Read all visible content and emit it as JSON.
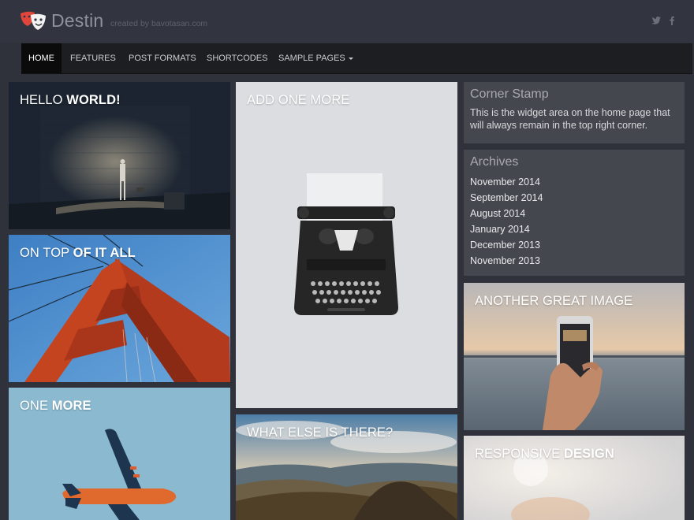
{
  "header": {
    "site_title": "Destin",
    "tagline": "created by bavotasan.com",
    "logo_icon": "theater-masks-icon",
    "social": [
      "twitter-icon",
      "facebook-icon"
    ]
  },
  "nav": {
    "items": [
      {
        "label": "Home",
        "active": true
      },
      {
        "label": "Features"
      },
      {
        "label": "Post Formats"
      },
      {
        "label": "Shortcodes"
      },
      {
        "label": "Sample Pages",
        "has_dropdown": true
      }
    ]
  },
  "tiles": [
    {
      "title_light": "Hello ",
      "title_bold": "World!"
    },
    {
      "title_light": "Add One More",
      "title_bold": ""
    },
    {
      "title_light": "On Top ",
      "title_bold": "of it all"
    },
    {
      "title_light": "One ",
      "title_bold": "More"
    },
    {
      "title_light": "What Else is There?",
      "title_bold": ""
    },
    {
      "title_light": "Another Great Image",
      "title_bold": ""
    },
    {
      "title_light": "Responsive ",
      "title_bold": "Design"
    }
  ],
  "widgets": {
    "corner_stamp": {
      "title": "Corner Stamp",
      "text": "This is the widget area on the home page that will always remain in the top right corner."
    },
    "archives": {
      "title": "Archives",
      "items": [
        "November 2014",
        "September 2014",
        "August 2014",
        "January 2014",
        "December 2013",
        "November 2013"
      ]
    }
  },
  "colors": {
    "background": "#2f313b",
    "nav_bg": "#1d1e22",
    "widget_bg": "#45474e",
    "logo_red": "#e0463b"
  }
}
